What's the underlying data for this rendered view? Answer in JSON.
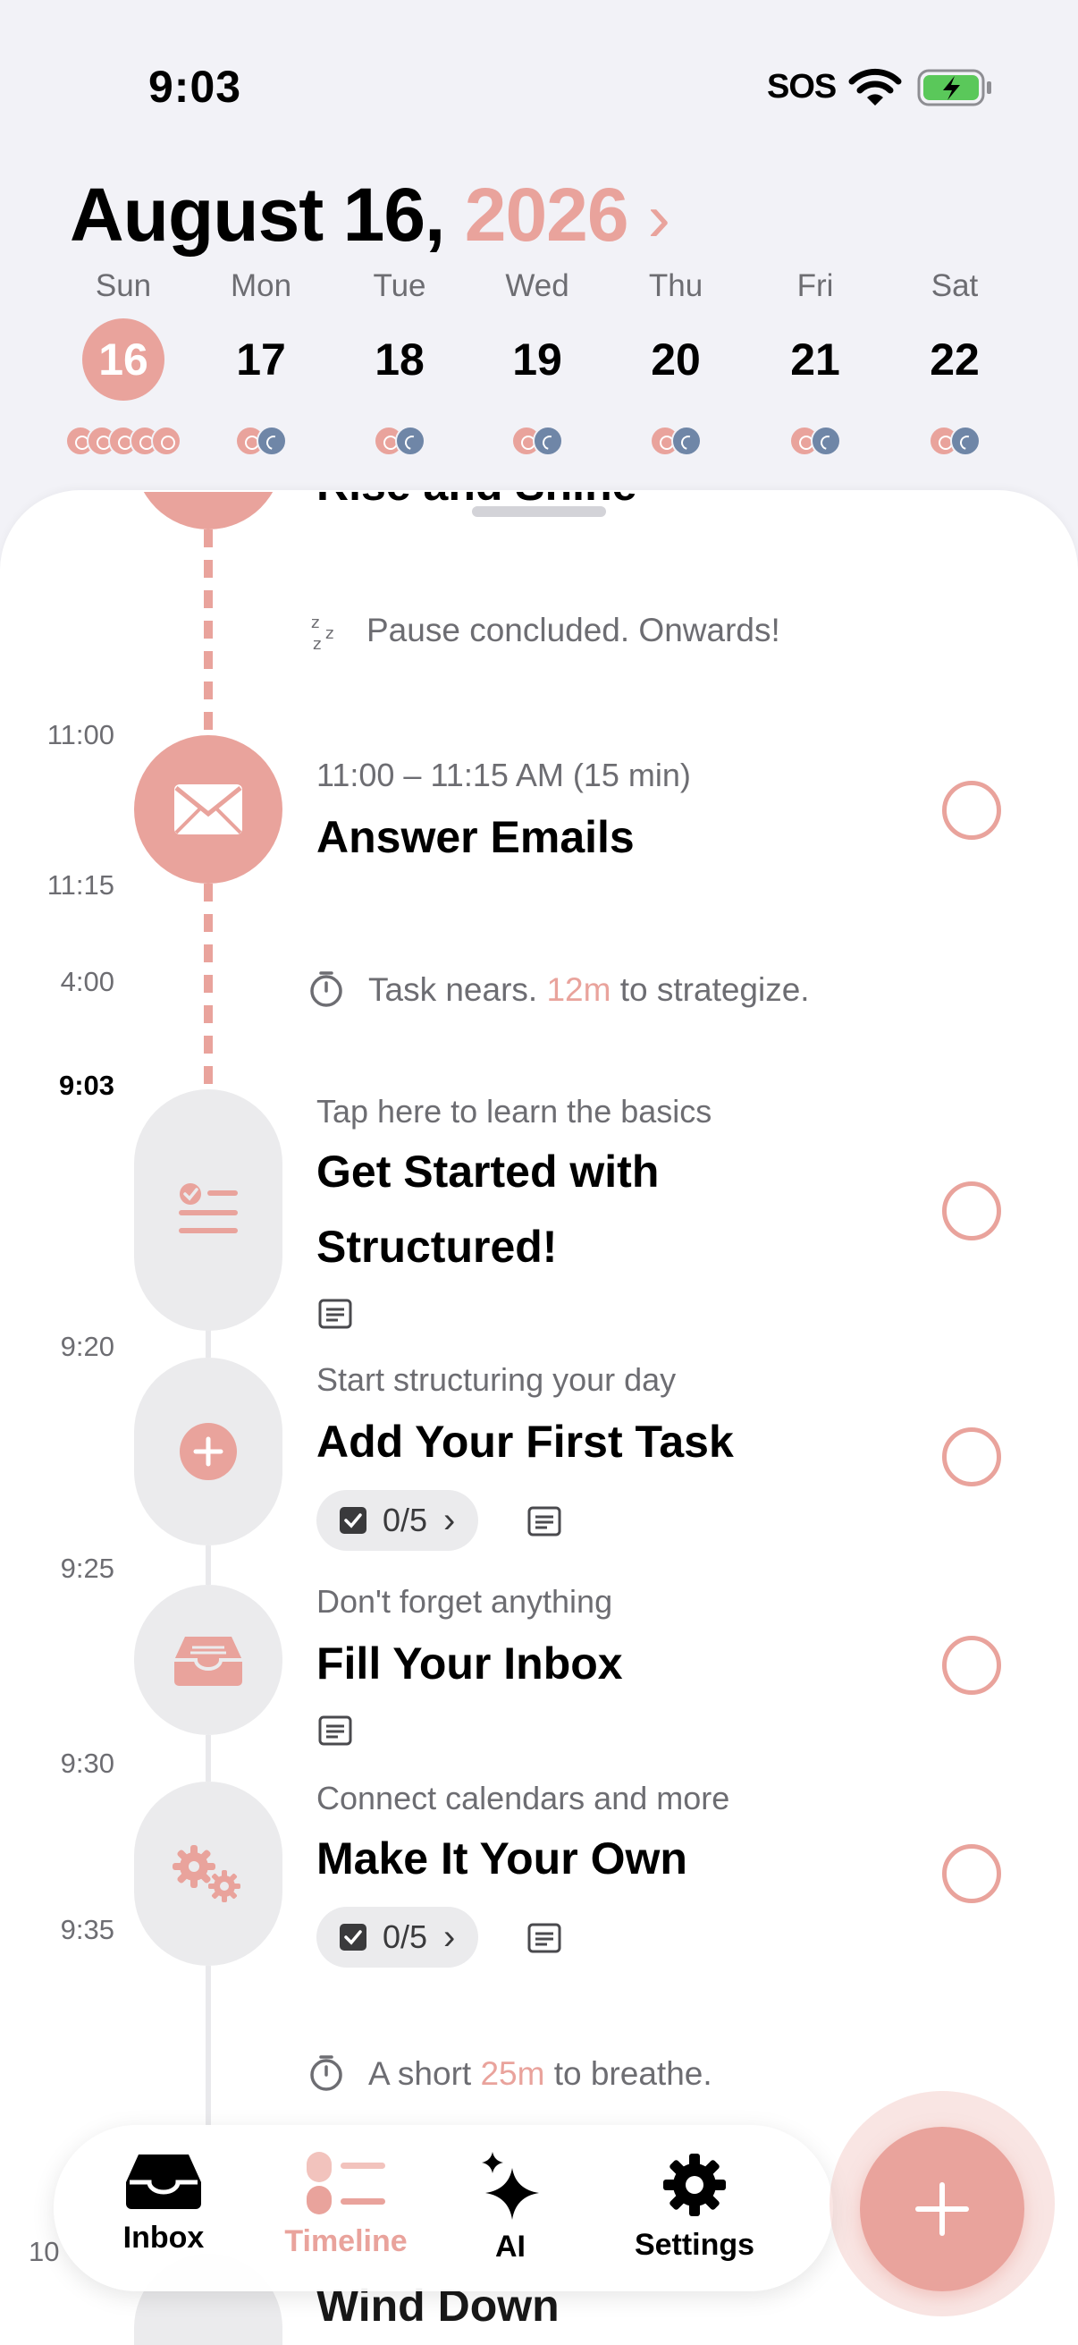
{
  "status_bar": {
    "time": "9:03",
    "carrier": "SOS"
  },
  "header": {
    "month_day": "August 16,",
    "year": "2026",
    "chevron": "›"
  },
  "week": [
    {
      "name": "Sun",
      "num": "16",
      "selected": true
    },
    {
      "name": "Mon",
      "num": "17"
    },
    {
      "name": "Tue",
      "num": "18"
    },
    {
      "name": "Wed",
      "num": "19"
    },
    {
      "name": "Thu",
      "num": "20"
    },
    {
      "name": "Fri",
      "num": "21"
    },
    {
      "name": "Sat",
      "num": "22"
    }
  ],
  "timeline": {
    "top_partial_title": "Rise and Shine",
    "pause1": {
      "text": "Pause concluded. Onwards!"
    },
    "pause2": {
      "pre": "Task nears. ",
      "highlight": "12m",
      "post": " to strategize."
    },
    "pause3": {
      "pre": "A short ",
      "highlight": "25m",
      "post": " to breathe."
    },
    "time_labels": {
      "t1100": "11:00",
      "t1115": "11:15",
      "t400": "4:00",
      "now": "9:03",
      "t920": "9:20",
      "t925": "9:25",
      "t930": "9:30",
      "t935": "9:35",
      "t10": "10"
    },
    "tasks": {
      "emails": {
        "subtitle": "11:00 – 11:15 AM (15 min)",
        "title": "Answer Emails"
      },
      "started": {
        "subtitle": "Tap here to learn the basics",
        "title_line1": "Get Started with",
        "title_line2": "Structured!"
      },
      "first": {
        "subtitle": "Start structuring your day",
        "title": "Add Your First Task",
        "subtasks": "0/5"
      },
      "inbox": {
        "subtitle": "Don't forget anything",
        "title": "Fill Your Inbox"
      },
      "own": {
        "subtitle": "Connect calendars and more",
        "title": "Make It Your Own",
        "subtasks": "0/5"
      }
    },
    "bottom_partial_title": "Wind Down"
  },
  "tabbar": {
    "inbox": "Inbox",
    "timeline": "Timeline",
    "ai": "AI",
    "settings": "Settings"
  },
  "colors": {
    "accent": "#e9a39c",
    "night": "#6f86a7",
    "background": "#f2f2f7"
  }
}
